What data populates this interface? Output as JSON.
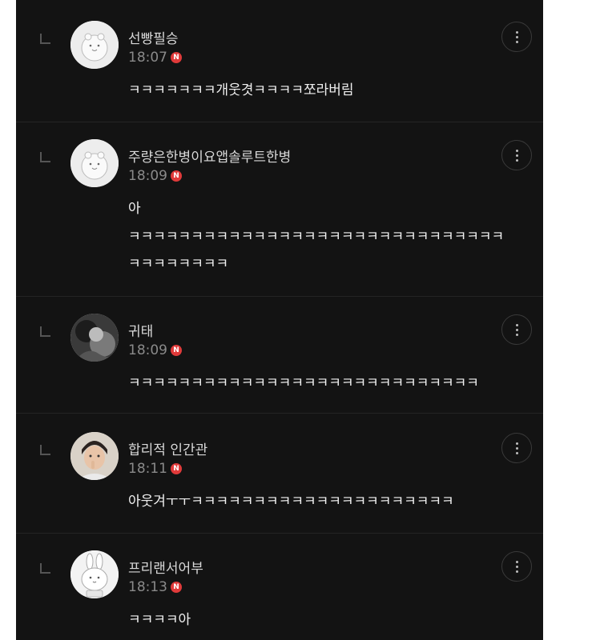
{
  "comments": [
    {
      "author": "선빵필승",
      "time": "18:07",
      "badge": "N",
      "text": "ㅋㅋㅋㅋㅋㅋㅋ개웃겻ㅋㅋㅋㅋ쪼라버림",
      "avatar": "hamster-avatar"
    },
    {
      "author": "주량은한병이요앱솔루트한병",
      "time": "18:09",
      "badge": "N",
      "text": "아",
      "text2": "ㅋㅋㅋㅋㅋㅋㅋㅋㅋㅋㅋㅋㅋㅋㅋㅋㅋㅋㅋㅋㅋㅋㅋㅋㅋㅋㅋㅋㅋㅋㅋㅋㅋㅋㅋㅋㅋㅋ",
      "avatar": "hamster-avatar"
    },
    {
      "author": "귀태",
      "time": "18:09",
      "badge": "N",
      "text": "ㅋㅋㅋㅋㅋㅋㅋㅋㅋㅋㅋㅋㅋㅋㅋㅋㅋㅋㅋㅋㅋㅋㅋㅋㅋㅋㅋㅋ",
      "avatar": "photo-avatar"
    },
    {
      "author": "합리적 인간관",
      "time": "18:11",
      "badge": "N",
      "text": "아웃겨ㅜㅜㅋㅋㅋㅋㅋㅋㅋㅋㅋㅋㅋㅋㅋㅋㅋㅋㅋㅋㅋㅋㅋ",
      "avatar": "child-photo-avatar"
    },
    {
      "author": "프리랜서어부",
      "time": "18:13",
      "badge": "N",
      "text": "ㅋㅋㅋㅋ아",
      "avatar": "rabbit-avatar"
    }
  ],
  "colors": {
    "background": "#131313",
    "badge": "#e03a3a",
    "name": "#d8d8d8",
    "time": "#8a8a8a"
  },
  "icons": {
    "reply": "reply-indent-icon",
    "more": "more-vertical-icon",
    "badge": "new-badge-icon"
  }
}
